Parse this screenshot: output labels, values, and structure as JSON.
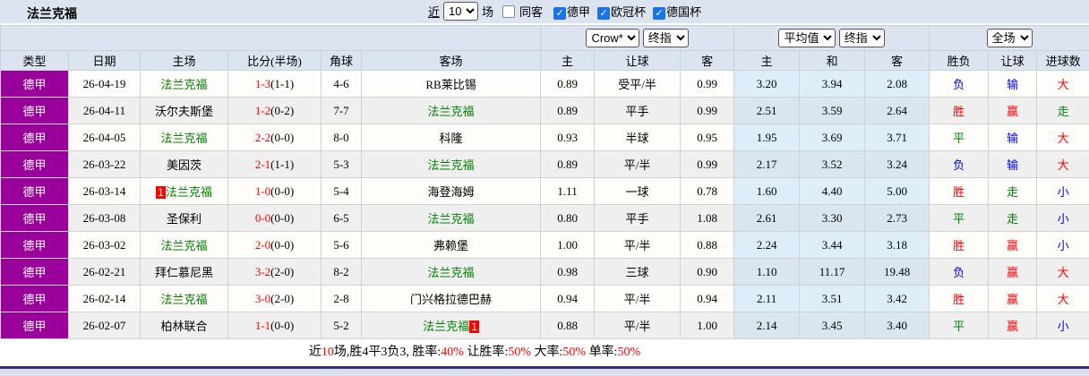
{
  "header": {
    "title": "法兰克福",
    "near_label": "近",
    "near_count": "10",
    "games_suffix": "场",
    "same_away_label": "同客",
    "filters": [
      {
        "label": "德甲",
        "checked": true
      },
      {
        "label": "欧冠杯",
        "checked": true
      },
      {
        "label": "德国杯",
        "checked": true
      }
    ]
  },
  "controls": {
    "odds_company": "Crow*",
    "odds_company_stage": "终指",
    "avg_source": "平均值",
    "avg_stage": "终指",
    "scope": "全场"
  },
  "columns": {
    "type": "类型",
    "date": "日期",
    "home": "主场",
    "score": "比分(半场)",
    "corner": "角球",
    "away": "客场",
    "odds_home": "主",
    "odds_handicap": "让球",
    "odds_away": "客",
    "avg_home": "主",
    "avg_draw": "和",
    "avg_away": "客",
    "result_wdl": "胜负",
    "result_handicap": "让球",
    "result_goals": "进球数"
  },
  "colors": {
    "league_purple": "#990099",
    "self_team_green": "#008000",
    "red": "#ff0000",
    "blue": "#0000ff",
    "header_bg": "#dbe4f0",
    "avg_col_bg": "#ddeef8"
  },
  "rows": [
    {
      "type": "德甲",
      "date": "26-04-19",
      "home": {
        "name": "法兰克福",
        "self": true,
        "badge": ""
      },
      "score": "1-3",
      "half": "(1-1)",
      "corners": "4-6",
      "away": {
        "name": "RB莱比锡",
        "self": false,
        "badge": ""
      },
      "odds": [
        "0.89",
        "受平/半",
        "0.99"
      ],
      "avg": [
        "3.20",
        "3.94",
        "2.08"
      ],
      "results": [
        {
          "text": "负",
          "color": "#0000ff"
        },
        {
          "text": "输",
          "color": "#0000ff"
        },
        {
          "text": "大",
          "color": "#ff0000"
        }
      ]
    },
    {
      "type": "德甲",
      "date": "26-04-11",
      "home": {
        "name": "沃尔夫斯堡",
        "self": false,
        "badge": ""
      },
      "score": "1-2",
      "half": "(0-2)",
      "corners": "7-7",
      "away": {
        "name": "法兰克福",
        "self": true,
        "badge": ""
      },
      "odds": [
        "0.89",
        "平手",
        "0.99"
      ],
      "avg": [
        "2.51",
        "3.59",
        "2.64"
      ],
      "results": [
        {
          "text": "胜",
          "color": "#ff0000"
        },
        {
          "text": "赢",
          "color": "#ff0000"
        },
        {
          "text": "走",
          "color": "#008000"
        }
      ]
    },
    {
      "type": "德甲",
      "date": "26-04-05",
      "home": {
        "name": "法兰克福",
        "self": true,
        "badge": ""
      },
      "score": "2-2",
      "half": "(0-0)",
      "corners": "8-0",
      "away": {
        "name": "科隆",
        "self": false,
        "badge": ""
      },
      "odds": [
        "0.93",
        "半球",
        "0.95"
      ],
      "avg": [
        "1.95",
        "3.69",
        "3.71"
      ],
      "results": [
        {
          "text": "平",
          "color": "#008000"
        },
        {
          "text": "输",
          "color": "#0000ff"
        },
        {
          "text": "大",
          "color": "#ff0000"
        }
      ]
    },
    {
      "type": "德甲",
      "date": "26-03-22",
      "home": {
        "name": "美因茨",
        "self": false,
        "badge": ""
      },
      "score": "2-1",
      "half": "(1-1)",
      "corners": "5-3",
      "away": {
        "name": "法兰克福",
        "self": true,
        "badge": ""
      },
      "odds": [
        "0.89",
        "平/半",
        "0.99"
      ],
      "avg": [
        "2.17",
        "3.52",
        "3.24"
      ],
      "results": [
        {
          "text": "负",
          "color": "#0000ff"
        },
        {
          "text": "输",
          "color": "#0000ff"
        },
        {
          "text": "大",
          "color": "#ff0000"
        }
      ]
    },
    {
      "type": "德甲",
      "date": "26-03-14",
      "home": {
        "name": "法兰克福",
        "self": true,
        "badge": "1"
      },
      "score": "1-0",
      "half": "(0-0)",
      "corners": "5-4",
      "away": {
        "name": "海登海姆",
        "self": false,
        "badge": ""
      },
      "odds": [
        "1.11",
        "一球",
        "0.78"
      ],
      "avg": [
        "1.60",
        "4.40",
        "5.00"
      ],
      "results": [
        {
          "text": "胜",
          "color": "#ff0000"
        },
        {
          "text": "走",
          "color": "#008000"
        },
        {
          "text": "小",
          "color": "#0000ff"
        }
      ]
    },
    {
      "type": "德甲",
      "date": "26-03-08",
      "home": {
        "name": "圣保利",
        "self": false,
        "badge": ""
      },
      "score": "0-0",
      "half": "(0-0)",
      "corners": "6-5",
      "away": {
        "name": "法兰克福",
        "self": true,
        "badge": ""
      },
      "odds": [
        "0.80",
        "平手",
        "1.08"
      ],
      "avg": [
        "2.61",
        "3.30",
        "2.73"
      ],
      "results": [
        {
          "text": "平",
          "color": "#008000"
        },
        {
          "text": "走",
          "color": "#008000"
        },
        {
          "text": "小",
          "color": "#0000ff"
        }
      ]
    },
    {
      "type": "德甲",
      "date": "26-03-02",
      "home": {
        "name": "法兰克福",
        "self": true,
        "badge": ""
      },
      "score": "2-0",
      "half": "(0-0)",
      "corners": "5-6",
      "away": {
        "name": "弗赖堡",
        "self": false,
        "badge": ""
      },
      "odds": [
        "1.00",
        "平/半",
        "0.88"
      ],
      "avg": [
        "2.24",
        "3.44",
        "3.18"
      ],
      "results": [
        {
          "text": "胜",
          "color": "#ff0000"
        },
        {
          "text": "赢",
          "color": "#ff0000"
        },
        {
          "text": "小",
          "color": "#0000ff"
        }
      ]
    },
    {
      "type": "德甲",
      "date": "26-02-21",
      "home": {
        "name": "拜仁慕尼黑",
        "self": false,
        "badge": ""
      },
      "score": "3-2",
      "half": "(2-0)",
      "corners": "8-2",
      "away": {
        "name": "法兰克福",
        "self": true,
        "badge": ""
      },
      "odds": [
        "0.98",
        "三球",
        "0.90"
      ],
      "avg": [
        "1.10",
        "11.17",
        "19.48"
      ],
      "results": [
        {
          "text": "负",
          "color": "#0000ff"
        },
        {
          "text": "赢",
          "color": "#ff0000"
        },
        {
          "text": "大",
          "color": "#ff0000"
        }
      ]
    },
    {
      "type": "德甲",
      "date": "26-02-14",
      "home": {
        "name": "法兰克福",
        "self": true,
        "badge": ""
      },
      "score": "3-0",
      "half": "(2-0)",
      "corners": "2-8",
      "away": {
        "name": "门兴格拉德巴赫",
        "self": false,
        "badge": ""
      },
      "odds": [
        "0.94",
        "平/半",
        "0.94"
      ],
      "avg": [
        "2.11",
        "3.51",
        "3.42"
      ],
      "results": [
        {
          "text": "胜",
          "color": "#ff0000"
        },
        {
          "text": "赢",
          "color": "#ff0000"
        },
        {
          "text": "大",
          "color": "#ff0000"
        }
      ]
    },
    {
      "type": "德甲",
      "date": "26-02-07",
      "home": {
        "name": "柏林联合",
        "self": false,
        "badge": ""
      },
      "score": "1-1",
      "half": "(0-0)",
      "corners": "5-2",
      "away": {
        "name": "法兰克福",
        "self": true,
        "badge": "1"
      },
      "odds": [
        "0.88",
        "平/半",
        "1.00"
      ],
      "avg": [
        "2.14",
        "3.45",
        "3.40"
      ],
      "results": [
        {
          "text": "平",
          "color": "#008000"
        },
        {
          "text": "赢",
          "color": "#ff0000"
        },
        {
          "text": "小",
          "color": "#0000ff"
        }
      ]
    }
  ],
  "summary": {
    "segments": [
      {
        "text": "近",
        "color": "#000000"
      },
      {
        "text": "10",
        "color": "#ff0000"
      },
      {
        "text": "场,胜4平3负3, 胜率:",
        "color": "#000000"
      },
      {
        "text": "40%",
        "color": "#ff0000"
      },
      {
        "text": " 让胜率:",
        "color": "#000000"
      },
      {
        "text": "50%",
        "color": "#ff0000"
      },
      {
        "text": " 大率:",
        "color": "#000000"
      },
      {
        "text": "50%",
        "color": "#ff0000"
      },
      {
        "text": " 单率:",
        "color": "#000000"
      },
      {
        "text": "50%",
        "color": "#ff0000"
      }
    ]
  }
}
